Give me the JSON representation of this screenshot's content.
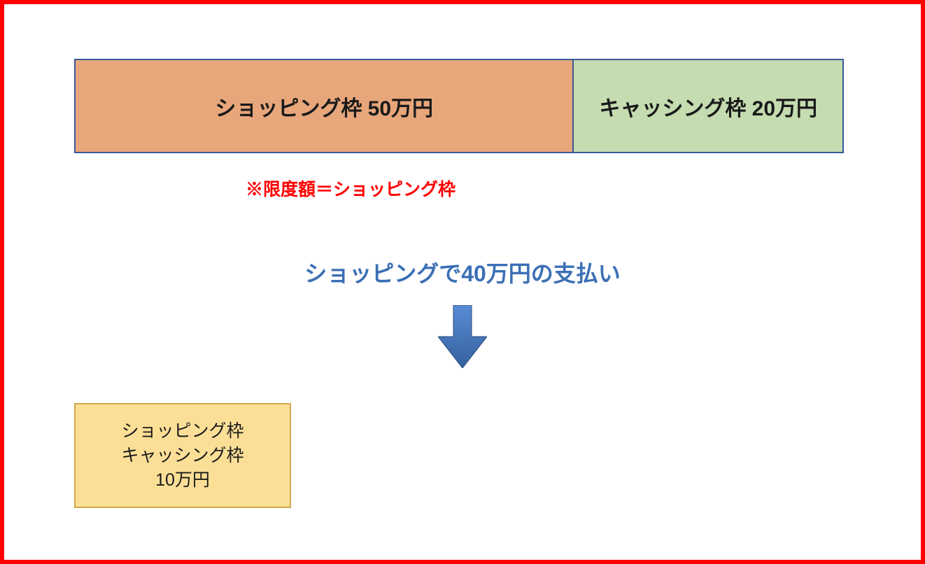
{
  "topBar": {
    "shopping": "ショッピング枠 50万円",
    "cashing": "キャッシング枠 20万円"
  },
  "note": "※限度額＝ショッピング枠",
  "middleText": "ショッピングで40万円の支払い",
  "resultBox": {
    "line1": "ショッピング枠",
    "line2": "キャッシング枠",
    "line3": "10万円"
  }
}
